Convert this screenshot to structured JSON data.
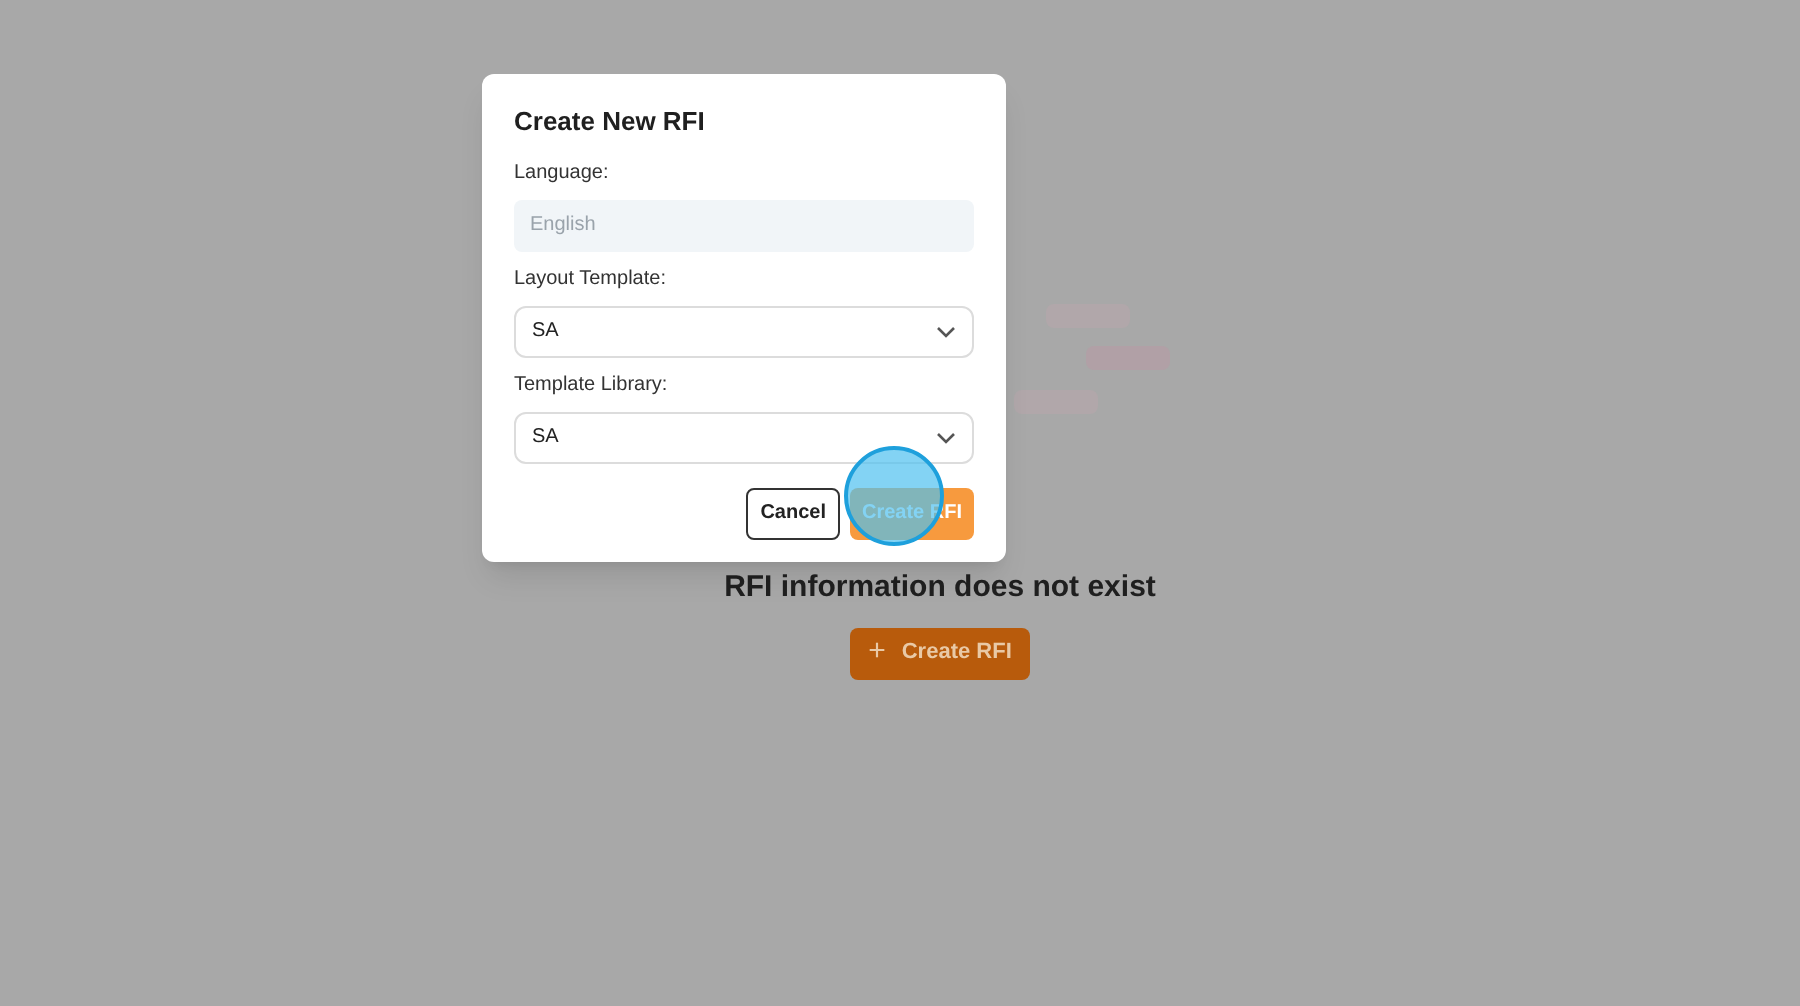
{
  "background": {
    "message": "RFI information does not exist",
    "create_button": {
      "icon": "+",
      "label": "Create RFI"
    }
  },
  "dialog": {
    "title": "Create New RFI",
    "fields": [
      {
        "kind": "text",
        "label": "Language:",
        "placeholder": "English",
        "disabled": true
      },
      {
        "kind": "select",
        "label": "Layout Template:",
        "value": "SA"
      },
      {
        "kind": "select",
        "label": "Template Library:",
        "value": "SA"
      }
    ],
    "buttons": [
      {
        "kind": "secondary",
        "label": "Cancel"
      },
      {
        "kind": "primary",
        "label": "Create RFI"
      }
    ]
  }
}
